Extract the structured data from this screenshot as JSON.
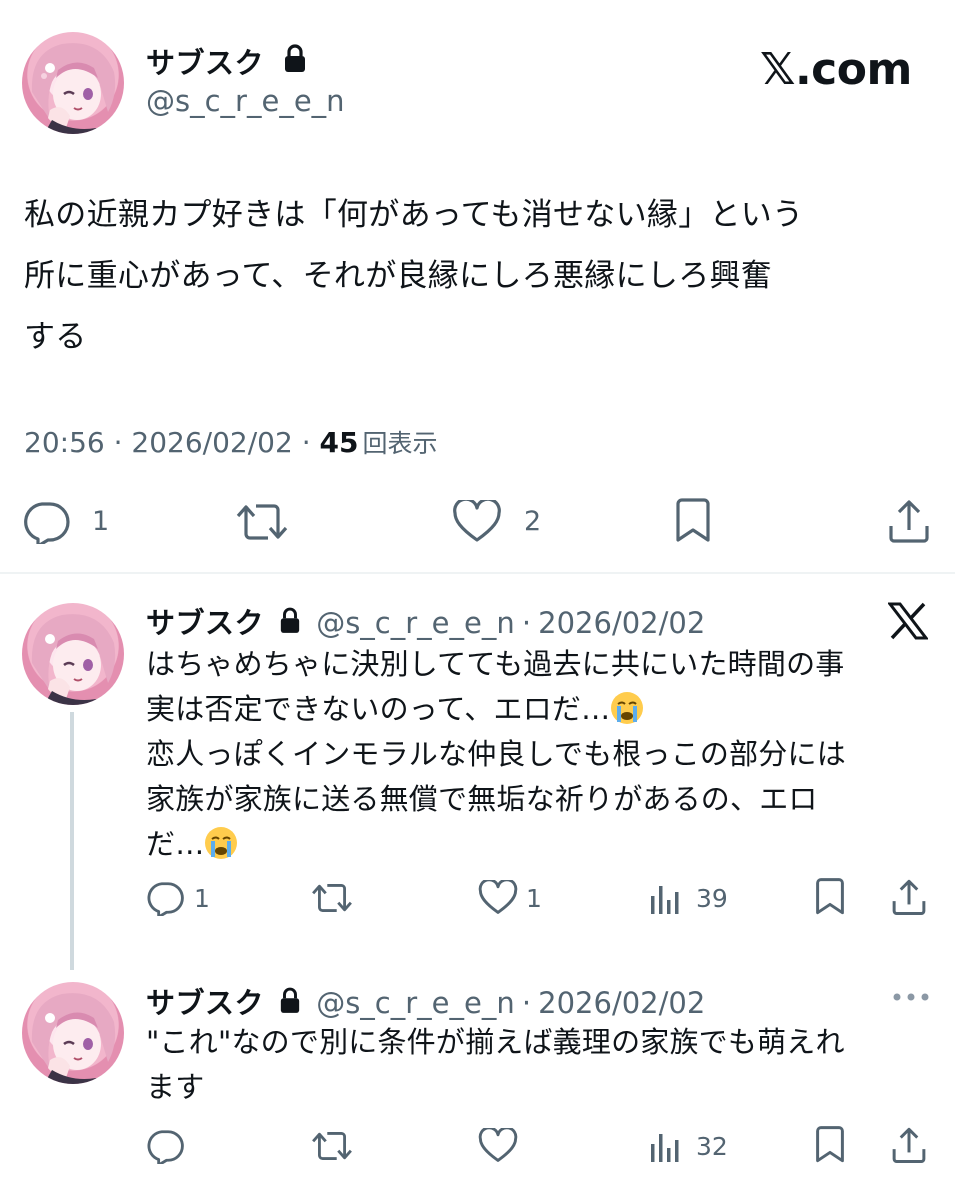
{
  "main_tweet": {
    "display_name": "サブスク",
    "handle": "@s_c_r_e_e_n",
    "brand": "𝕏.com",
    "text_lines": [
      "私の近親カプ好きは「何があっても消せない縁」という",
      "所に重心があって、それが良縁にしろ悪縁にしろ興奮",
      "する"
    ],
    "time": "20:56",
    "date": "2026/02/02",
    "views_count": "45",
    "views_label": "回表示",
    "sep": " · ",
    "replies": "1",
    "likes": "2"
  },
  "reply1": {
    "display_name": "サブスク",
    "handle": "@s_c_r_e_e_n",
    "date_sep": "·",
    "date": "2026/02/02",
    "lines": [
      "はちゃめちゃに決別してても過去に共にいた時間の事",
      "実は否定できないのって、エロだ…",
      "恋人っぽくインモラルな仲良しでも根っこの部分には",
      "家族が家族に送る無償で無垢な祈りがあるの、エロ",
      "だ…"
    ],
    "replies": "1",
    "likes": "1",
    "views": "39"
  },
  "reply2": {
    "display_name": "サブスク",
    "handle": "@s_c_r_e_e_n",
    "date_sep": "·",
    "date": "2026/02/02",
    "lines": [
      "\"これ\"なので別に条件が揃えば義理の家族でも萌えれ",
      "ます"
    ],
    "views": "32"
  },
  "colors": {
    "text": "#0f1419",
    "secondary": "#536471",
    "divider": "#eff3f4",
    "thread_line": "#cfd9de"
  },
  "icons": [
    "lock-icon",
    "x-logo-icon",
    "reply-icon",
    "retweet-icon",
    "like-icon",
    "bookmark-icon",
    "share-icon",
    "views-icon",
    "more-icon",
    "crying-emoji"
  ]
}
